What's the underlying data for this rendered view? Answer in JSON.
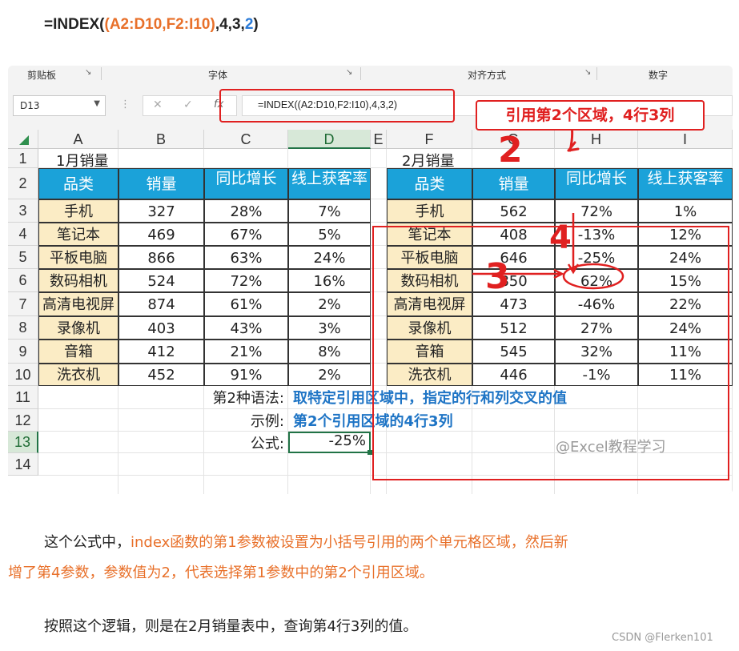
{
  "top_formula": {
    "prefix": "=INDEX(",
    "ranges": "(A2:D10,F2:I10)",
    "args": ",4,3,",
    "area": "2",
    "suffix": ")"
  },
  "ribbon": {
    "groups": [
      "剪贴板",
      "字体",
      "对齐方式",
      "数字"
    ],
    "launcher_icon": "dialog-launcher-icon"
  },
  "formula_bar": {
    "name_box": "D13",
    "cancel_icon": "✕",
    "enter_icon": "✓",
    "fx_icon": "fx",
    "formula": "=INDEX((A2:D10,F2:I10),4,3,2)"
  },
  "annotation": {
    "callout": "引用第2个区域，4行3列",
    "marks": [
      "2",
      "3",
      "4"
    ],
    "accent_color": "#e02020"
  },
  "grid": {
    "columns": [
      "A",
      "B",
      "C",
      "D",
      "E",
      "F",
      "G",
      "H",
      "I"
    ],
    "rows": [
      "1",
      "2",
      "3",
      "4",
      "5",
      "6",
      "7",
      "8",
      "9",
      "10",
      "11",
      "12",
      "13",
      "14"
    ],
    "table1": {
      "title": "1月销量",
      "headers": [
        "品类",
        "销量",
        "同比增长",
        "线上获客率"
      ],
      "rows": [
        [
          "手机",
          "327",
          "28%",
          "7%"
        ],
        [
          "笔记本",
          "469",
          "67%",
          "5%"
        ],
        [
          "平板电脑",
          "866",
          "63%",
          "24%"
        ],
        [
          "数码相机",
          "524",
          "72%",
          "16%"
        ],
        [
          "高清电视屏",
          "874",
          "61%",
          "2%"
        ],
        [
          "录像机",
          "403",
          "43%",
          "3%"
        ],
        [
          "音箱",
          "412",
          "21%",
          "8%"
        ],
        [
          "洗衣机",
          "452",
          "91%",
          "2%"
        ]
      ]
    },
    "table2": {
      "title": "2月销量",
      "headers": [
        "品类",
        "销量",
        "同比增长",
        "线上获客率"
      ],
      "rows": [
        [
          "手机",
          "562",
          "72%",
          "1%"
        ],
        [
          "笔记本",
          "408",
          "-13%",
          "12%"
        ],
        [
          "平板电脑",
          "646",
          "-25%",
          "24%"
        ],
        [
          "数码相机",
          "850",
          "62%",
          "15%"
        ],
        [
          "高清电视屏",
          "473",
          "-46%",
          "22%"
        ],
        [
          "录像机",
          "512",
          "27%",
          "24%"
        ],
        [
          "音箱",
          "545",
          "32%",
          "11%"
        ],
        [
          "洗衣机",
          "446",
          "-1%",
          "11%"
        ]
      ]
    },
    "notes": {
      "syntax_label": "第2种语法:",
      "syntax_text": "取特定引用区域中，指定的行和列交叉的值",
      "example_label": "示例:",
      "example_text": "第2个引用区域的4行3列",
      "formula_label": "公式:",
      "formula_result": "-25%"
    },
    "watermark": "@Excel教程学习",
    "header_color": "#1ba2d9",
    "category_color": "#fbecc5"
  },
  "paragraphs": {
    "p1_a": "这个公式中，",
    "p1_b": "index函数的第1参数被设置为小括号引用的两个单元格区域，然后新",
    "p1_c": "增了第4参数，参数值为2，代表选择第1参数中的第2个引用区域。",
    "p2": "按照这个逻辑，则是在2月销量表中，查询第4行3列的值。"
  },
  "footer": "CSDN @Flerken101"
}
